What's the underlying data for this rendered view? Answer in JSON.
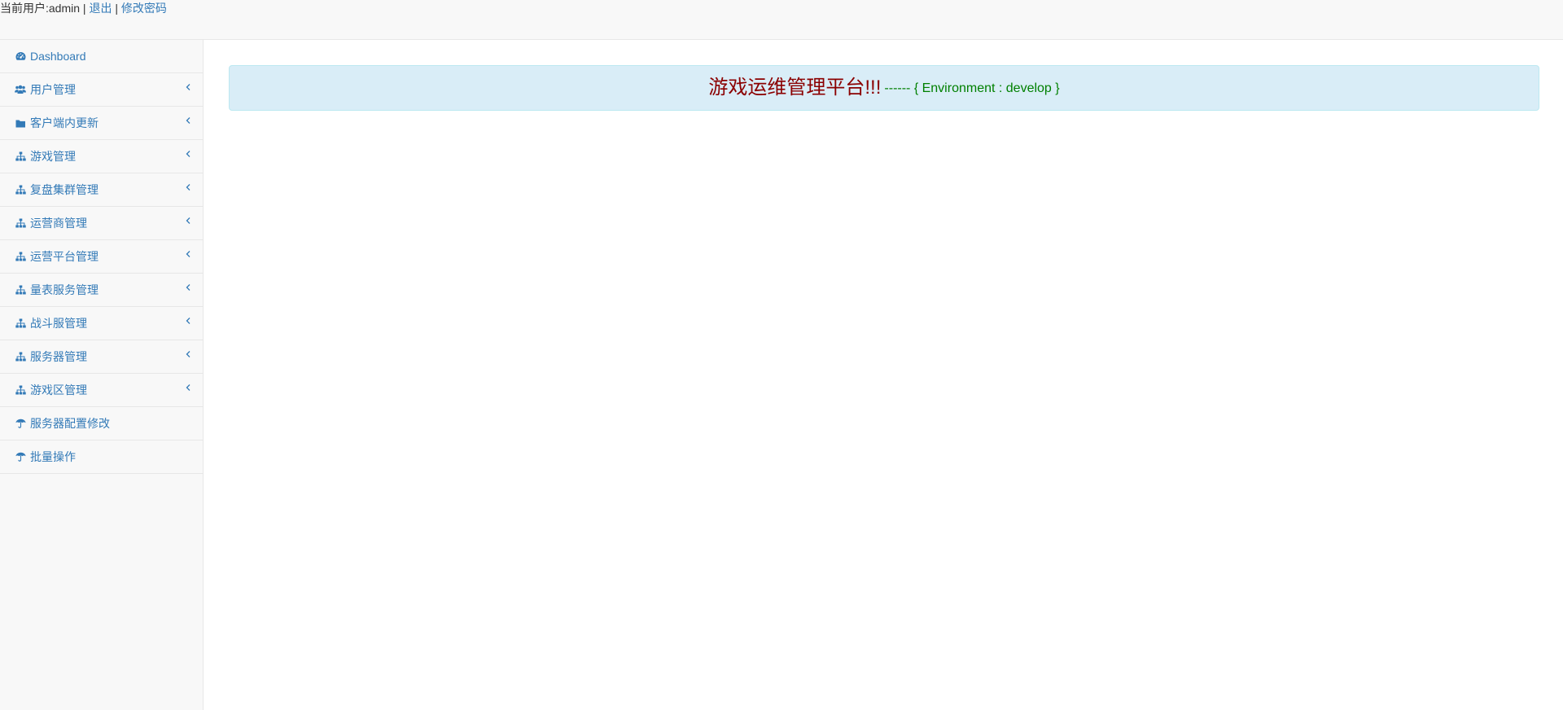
{
  "header": {
    "user_prefix": "当前用户:admin",
    "separator": "|",
    "logout_label": "退出",
    "change_password_label": "修改密码"
  },
  "sidebar": {
    "items": [
      {
        "label": "Dashboard",
        "icon": "dashboard-icon",
        "has_submenu": false
      },
      {
        "label": "用户管理",
        "icon": "users-icon",
        "has_submenu": true
      },
      {
        "label": "客户端内更新",
        "icon": "folder-icon",
        "has_submenu": true
      },
      {
        "label": "游戏管理",
        "icon": "sitemap-icon",
        "has_submenu": true
      },
      {
        "label": "复盘集群管理",
        "icon": "sitemap-icon",
        "has_submenu": true
      },
      {
        "label": "运营商管理",
        "icon": "sitemap-icon",
        "has_submenu": true
      },
      {
        "label": "运营平台管理",
        "icon": "sitemap-icon",
        "has_submenu": true
      },
      {
        "label": "量表服务管理",
        "icon": "sitemap-icon",
        "has_submenu": true
      },
      {
        "label": "战斗服管理",
        "icon": "sitemap-icon",
        "has_submenu": true
      },
      {
        "label": "服务器管理",
        "icon": "sitemap-icon",
        "has_submenu": true
      },
      {
        "label": "游戏区管理",
        "icon": "sitemap-icon",
        "has_submenu": true
      },
      {
        "label": "服务器配置修改",
        "icon": "umbrella-icon",
        "has_submenu": false
      },
      {
        "label": "批量操作",
        "icon": "umbrella-icon",
        "has_submenu": false
      }
    ]
  },
  "main": {
    "banner_title": "游戏运维管理平台!!!",
    "banner_env": "------ { Environment : develop }"
  },
  "colors": {
    "link": "#337ab7",
    "banner_bg": "#d9edf7",
    "banner_border": "#bce8f1",
    "title": "#8b0000",
    "env": "#008000",
    "sidebar_bg": "#f8f8f8"
  }
}
